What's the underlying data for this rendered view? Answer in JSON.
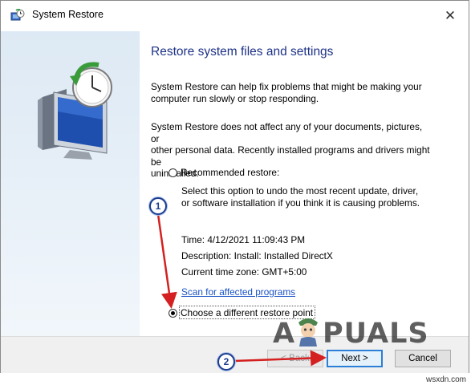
{
  "window": {
    "title": "System Restore",
    "close_glyph": "✕"
  },
  "content": {
    "heading": "Restore system files and settings",
    "para1_line1": "System Restore can help fix problems that might be making your",
    "para1_line2": "computer run slowly or stop responding.",
    "para2_line1": "System Restore does not affect any of your documents, pictures, or",
    "para2_line2": "other personal data. Recently installed programs and drivers might be",
    "para2_line3": "uninstalled.",
    "recommended_label": "Recommended restore:",
    "recommended_desc_line1": "Select this option to undo the most recent update, driver,",
    "recommended_desc_line2": "or software installation if you think it is causing problems.",
    "time": "Time: 4/12/2021 11:09:43 PM",
    "description": "Description: Install: Installed DirectX",
    "timezone": "Current time zone: GMT+5:00",
    "scan_link": "Scan for affected programs",
    "different_label": "Choose a different restore point",
    "selected_option": "different"
  },
  "footer": {
    "back_label": "< Back",
    "next_label": "Next >",
    "cancel_label": "Cancel"
  },
  "annotations": {
    "step1": "1",
    "step2": "2",
    "arrow_color": "#d42020"
  },
  "watermark": {
    "left": "A",
    "right": "PUALS",
    "site": "wsxdn.com"
  },
  "icons": [
    "system-restore-icon",
    "close-icon",
    "computer-clock-icon",
    "mascot-icon"
  ]
}
